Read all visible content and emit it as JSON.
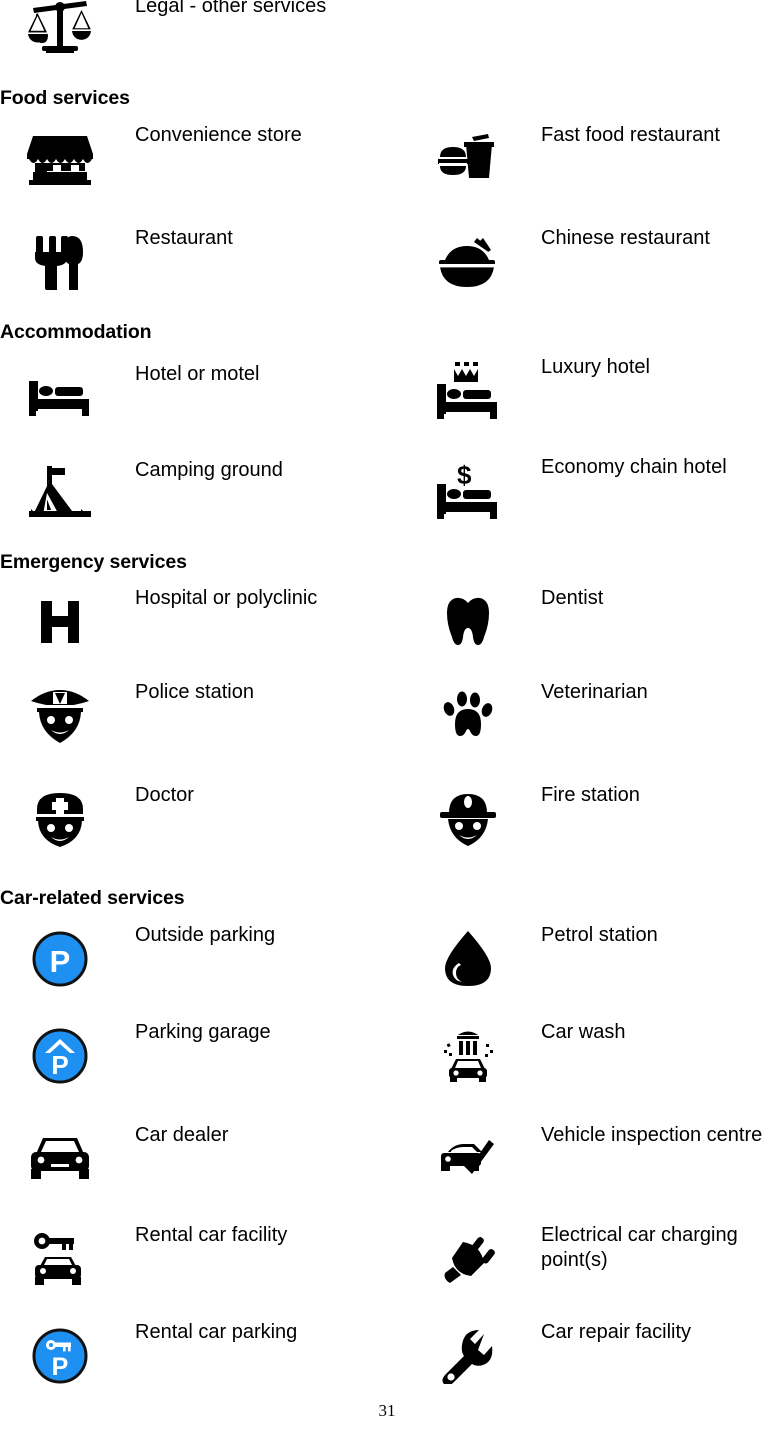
{
  "page": {
    "number": "31",
    "accent_blue": "#1e90f2",
    "text_color": "#000000",
    "background": "#ffffff"
  },
  "top_entry": {
    "icon": "scales-of-justice-icon",
    "label": "Legal - other services"
  },
  "sections": [
    {
      "heading": "Food services",
      "entries": [
        {
          "icon": "convenience-store-icon",
          "label": "Convenience store"
        },
        {
          "icon": "fast-food-icon",
          "label": "Fast food restaurant"
        },
        {
          "icon": "restaurant-cutlery-icon",
          "label": "Restaurant"
        },
        {
          "icon": "chinese-noodle-bowl-icon",
          "label": "Chinese restaurant"
        }
      ]
    },
    {
      "heading": "Accommodation",
      "entries": [
        {
          "icon": "bed-icon",
          "label": "Hotel or motel"
        },
        {
          "icon": "crown-bed-icon",
          "label": "Luxury hotel"
        },
        {
          "icon": "tent-icon",
          "label": "Camping ground"
        },
        {
          "icon": "dollar-bed-icon",
          "label": "Economy chain hotel"
        }
      ]
    },
    {
      "heading": "Emergency services",
      "entries": [
        {
          "icon": "hospital-h-icon",
          "label": "Hospital or polyclinic"
        },
        {
          "icon": "tooth-icon",
          "label": "Dentist"
        },
        {
          "icon": "police-officer-icon",
          "label": "Police station"
        },
        {
          "icon": "paw-print-icon",
          "label": "Veterinarian"
        },
        {
          "icon": "doctor-icon",
          "label": "Doctor"
        },
        {
          "icon": "firefighter-icon",
          "label": "Fire station"
        }
      ]
    },
    {
      "heading": "Car-related services",
      "entries": [
        {
          "icon": "parking-p-circle-icon",
          "label": "Outside parking"
        },
        {
          "icon": "fuel-drop-icon",
          "label": "Petrol station"
        },
        {
          "icon": "parking-garage-circle-icon",
          "label": "Parking garage"
        },
        {
          "icon": "car-wash-icon",
          "label": "Car wash"
        },
        {
          "icon": "car-front-icon",
          "label": "Car dealer"
        },
        {
          "icon": "car-check-icon",
          "label": "Vehicle inspection centre"
        },
        {
          "icon": "key-car-icon",
          "label": "Rental car facility"
        },
        {
          "icon": "power-plug-icon",
          "label": "Electrical car charging point(s)"
        },
        {
          "icon": "key-parking-circle-icon",
          "label": "Rental car parking"
        },
        {
          "icon": "wrench-icon",
          "label": "Car repair facility"
        }
      ]
    }
  ]
}
